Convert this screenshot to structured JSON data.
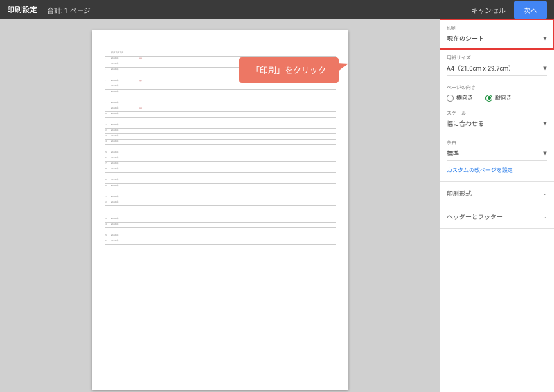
{
  "header": {
    "title": "印刷設定",
    "subtitle": "合計: 1 ページ",
    "cancel": "キャンセル",
    "next": "次へ"
  },
  "callout": {
    "text": "「印刷」をクリック"
  },
  "sidebar": {
    "print": {
      "label": "印刷",
      "value": "現在のシート"
    },
    "paper": {
      "label": "用紙サイズ",
      "value": "A4（21.0cm x 29.7cm）"
    },
    "orientation": {
      "label": "ページの向き",
      "landscape": "横向き",
      "portrait": "縦向き",
      "selected": "portrait"
    },
    "scale": {
      "label": "スケール",
      "value": "幅に合わせる"
    },
    "margin": {
      "label": "余白",
      "value": "標準"
    },
    "custom_breaks": "カスタムの改ページを設定",
    "format": "印刷形式",
    "header_footer": "ヘッダーとフッター"
  }
}
